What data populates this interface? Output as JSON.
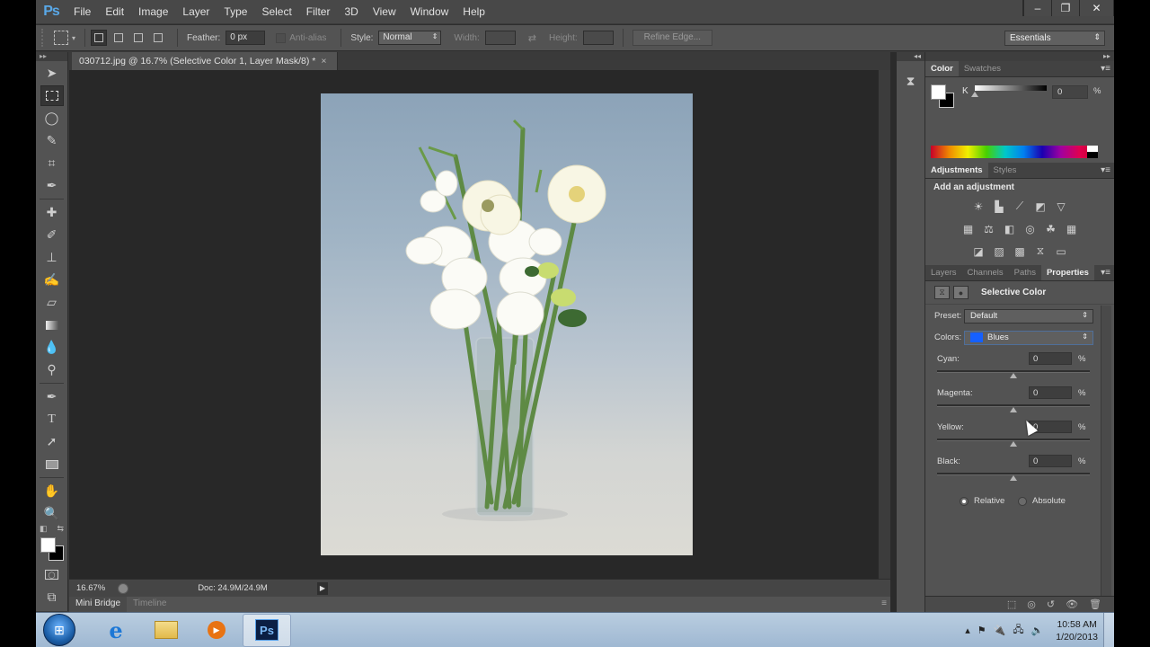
{
  "app": {
    "logo": "Ps",
    "menu": [
      "File",
      "Edit",
      "Image",
      "Layer",
      "Type",
      "Select",
      "Filter",
      "3D",
      "View",
      "Window",
      "Help"
    ],
    "window_controls": {
      "minimize": "–",
      "restore": "❐",
      "close": "✕"
    }
  },
  "options_bar": {
    "feather_label": "Feather:",
    "feather_value": "0 px",
    "antialias_label": "Anti-alias",
    "style_label": "Style:",
    "style_value": "Normal",
    "width_label": "Width:",
    "height_label": "Height:",
    "refine_edge_label": "Refine Edge...",
    "workspace_value": "Essentials"
  },
  "document": {
    "tab_title": "030712.jpg @ 16.7% (Selective Color 1, Layer Mask/8) *",
    "tab_close": "×",
    "zoom_level": "16.67%",
    "doc_size": "Doc: 24.9M/24.9M"
  },
  "bottom_tabs": [
    "Mini Bridge",
    "Timeline"
  ],
  "color_panel": {
    "tabs": [
      "Color",
      "Swatches"
    ],
    "channel_label": "K",
    "channel_value": "0",
    "unit": "%"
  },
  "adjustments_panel": {
    "tabs": [
      "Adjustments",
      "Styles"
    ],
    "title": "Add an adjustment",
    "icons_row1": [
      "brightness-contrast-icon",
      "levels-icon",
      "curves-icon",
      "exposure-icon",
      "vibrance-icon"
    ],
    "icons_row2": [
      "hue-saturation-icon",
      "color-balance-icon",
      "black-white-icon",
      "photo-filter-icon",
      "channel-mixer-icon",
      "color-lookup-icon"
    ],
    "icons_row3": [
      "invert-icon",
      "posterize-icon",
      "threshold-icon",
      "selective-color-icon",
      "gradient-map-icon"
    ]
  },
  "properties_panel": {
    "tabs": [
      "Layers",
      "Channels",
      "Paths",
      "Properties"
    ],
    "title": "Selective Color",
    "preset_label": "Preset:",
    "preset_value": "Default",
    "colors_label": "Colors:",
    "colors_value": "Blues",
    "colors_swatch": "#1560ff",
    "sliders": [
      {
        "label": "Cyan:",
        "value": "0",
        "unit": "%"
      },
      {
        "label": "Magenta:",
        "value": "0",
        "unit": "%"
      },
      {
        "label": "Yellow:",
        "value": "0",
        "unit": "%"
      },
      {
        "label": "Black:",
        "value": "0",
        "unit": "%"
      }
    ],
    "method_options": [
      "Relative",
      "Absolute"
    ],
    "method_selected": "Relative"
  },
  "taskbar": {
    "apps": [
      "Internet Explorer",
      "Windows Explorer",
      "Windows Media Player",
      "Adobe Photoshop"
    ],
    "time": "10:58 AM",
    "date": "1/20/2013"
  }
}
